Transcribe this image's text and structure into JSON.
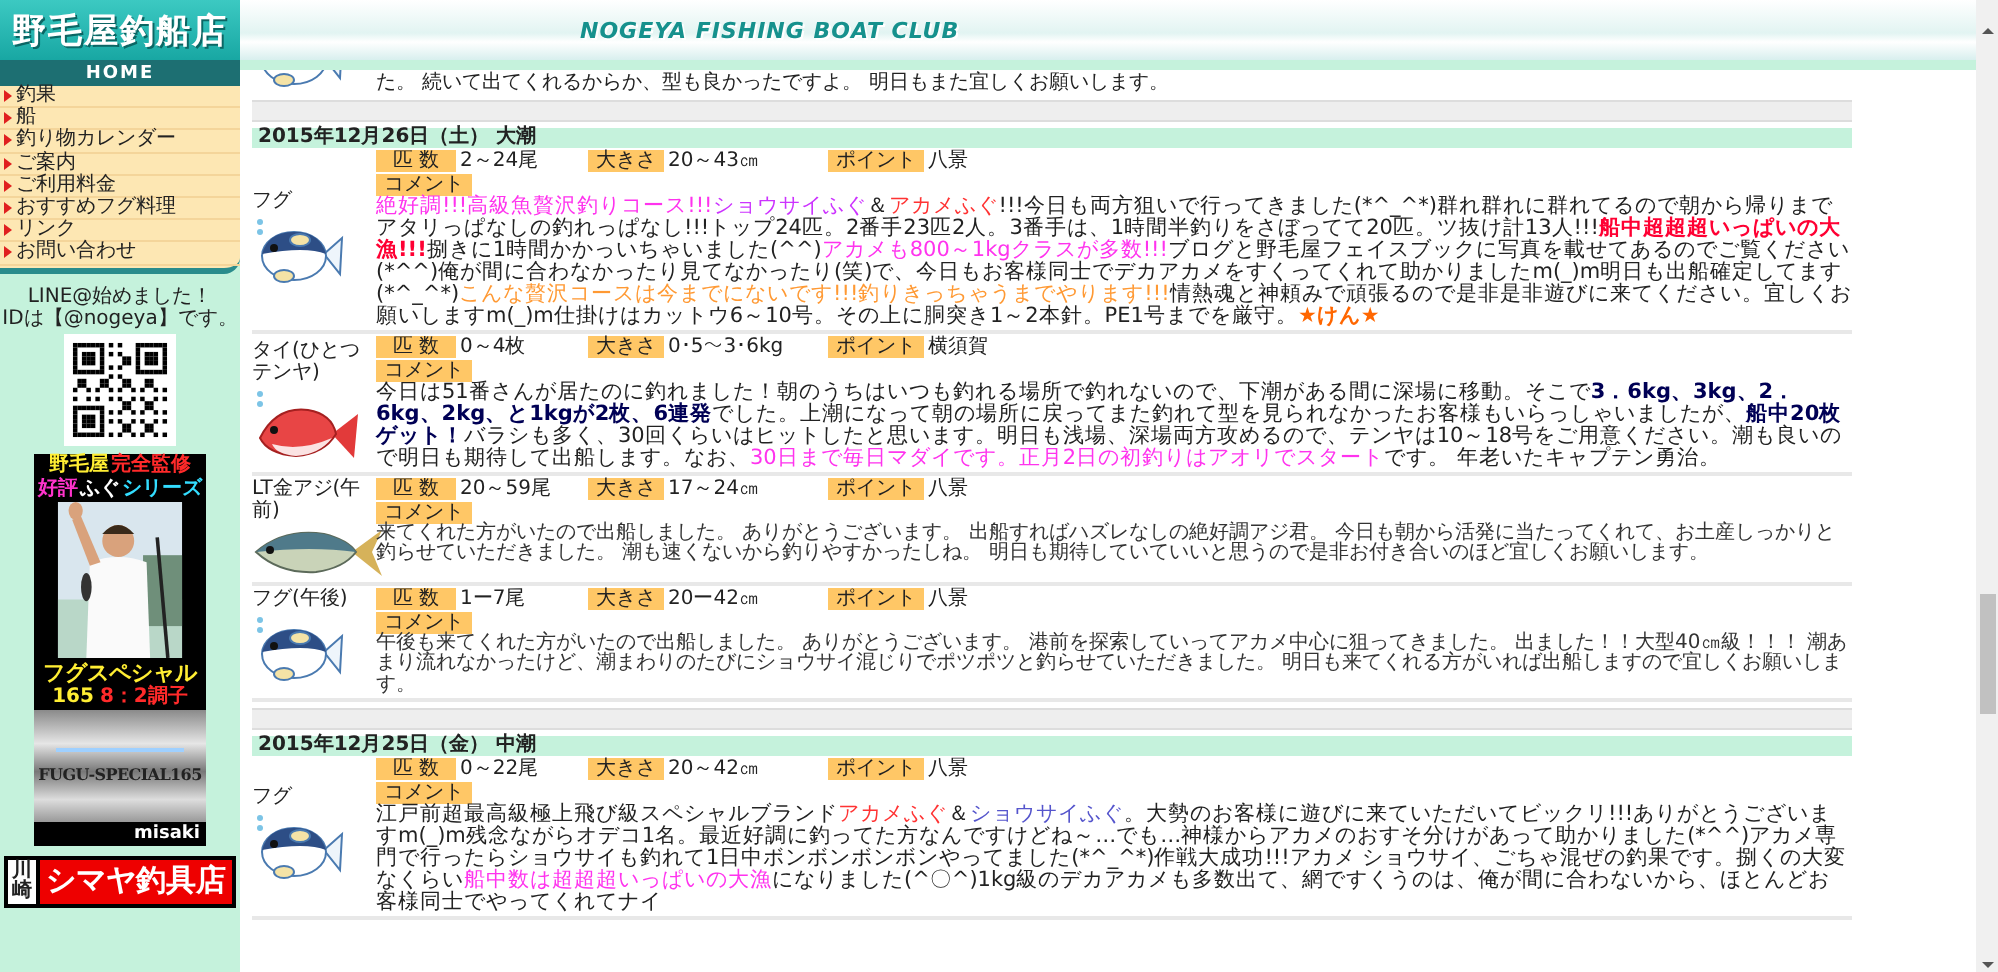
{
  "logo": {
    "title": "野毛屋釣船店"
  },
  "header": {
    "title": "NOGEYA FISHING BOAT CLUB"
  },
  "nav": {
    "home": "HOME",
    "items": [
      "釣果",
      "船",
      "釣り物カレンダー",
      "ご案内",
      "ご利用料金",
      "おすすめフグ料理",
      "リンク",
      "お問い合わせ"
    ]
  },
  "sidebar": {
    "line_notice": "LINE@始めました！",
    "line_id": "IDは【@nogeya】です。",
    "banner": {
      "maker": "野毛屋",
      "supervision": "完全監修",
      "praise": "好評",
      "series": "ふぐ",
      "series_word": "シリーズ",
      "product": "フグスペシャル",
      "length": "165",
      "action": "8：2調子",
      "rod_label": "FUGU-SPECIAL165",
      "brand": "misaki"
    },
    "shop": {
      "city": "川崎",
      "name": "シマヤ釣具店"
    }
  },
  "previous_entry": {
    "comment_tail": "た。 続いて出てくれるからか、型も良かったですよ。 明日もまた宜しくお願いします。"
  },
  "days": [
    {
      "date": "2015年12月26日（土） 大潮",
      "catches": [
        {
          "kind": "fugu",
          "fish": "フグ",
          "count_label": "匹 数",
          "count": "2～24尾",
          "size_label": "大きさ",
          "size": "20～43㎝",
          "point_label": "ポイント",
          "point": "八景",
          "comment_label": "コメント",
          "compact": false,
          "comment": [
            {
              "kind": "promo",
              "text": "絶好調!!!高級魚贅沢釣りコース!!!"
            },
            {
              "kind": "species",
              "text": "ショウサイふぐ"
            },
            {
              "kind": "plain",
              "text": "＆"
            },
            {
              "kind": "akame",
              "text": "アカメふぐ"
            },
            {
              "kind": "plain",
              "text": "!!!今日も両方狙いで行ってきました(*^_^*)群れ群れに群れてるので朝から帰りまでアタリっぱなしの釣れっぱなし!!!トップ24匹。2番手23匹2人。3番手は、1時間半釣りをさぼってて20匹。ツ抜け計13人!!!"
            },
            {
              "kind": "alert",
              "text": "船中超超超いっぱいの大漁!!!"
            },
            {
              "kind": "plain",
              "text": "捌きに1時間かかっいちゃいました(^^)"
            },
            {
              "kind": "promo",
              "text": "アカメも800～1kgクラスが多数!!!"
            },
            {
              "kind": "plain",
              "text": "ブログと野毛屋フェイスブックに写真を載せてあるのでご覧ください(*^^)俺が間に合わなかったり見てなかったり(笑)で、今日もお客様同士でデカアカメをすくってくれて助かりましたm(_)m明日も出船確定してます(*^_^*)"
            },
            {
              "kind": "notice",
              "text": "こんな贅沢コースは今までにないです!!!釣りきっちゃうまでやります!!!"
            },
            {
              "kind": "plain",
              "text": "情熱魂と神頼みで頑張るので是非是非遊びに来てください。宜しくお願いしますm(_)m仕掛けはカットウ6～10号。その上に胴突き1～2本針。PE1号までを厳守。"
            },
            {
              "kind": "sign",
              "text": "★けん★"
            }
          ]
        },
        {
          "kind": "tai",
          "fish": "タイ(ひとつテンヤ)",
          "count_label": "匹 数",
          "count": "0～4枚",
          "size_label": "大きさ",
          "size": "0･5～3･6kg",
          "point_label": "ポイント",
          "point": "横須賀",
          "comment_label": "コメント",
          "compact": false,
          "comment": [
            {
              "kind": "plain",
              "text": "今日は51番さんが居たのに釣れました！朝のうちはいつも釣れる場所で釣れないので、下潮がある間に深場に移動。そこで"
            },
            {
              "kind": "strong",
              "text": "3．6kg、3kg、2．6kg、2kg、と1kgが2枚、6連発"
            },
            {
              "kind": "plain",
              "text": "でした。上潮になって朝の場所に戻ってまた釣れて型を見られなかったお客様もいらっしゃいましたが、"
            },
            {
              "kind": "strong",
              "text": "船中20枚ゲット！"
            },
            {
              "kind": "plain",
              "text": "バラシも多く、30回くらいはヒットしたと思います。明日も浅場、深場両方攻めるので、テンヤは10～18号をご用意ください。潮も良いので明日も期待して出船します。なお、"
            },
            {
              "kind": "promo",
              "text": "30日まで毎日マダイです。正月2日の初釣りはアオリでスタート"
            },
            {
              "kind": "plain",
              "text": "です。 年老いたキャプテン勇治。"
            }
          ]
        },
        {
          "kind": "aji",
          "fish": "LT金アジ(午前)",
          "count_label": "匹 数",
          "count": "20～59尾",
          "size_label": "大きさ",
          "size": "17～24㎝",
          "point_label": "ポイント",
          "point": "八景",
          "comment_label": "コメント",
          "compact": true,
          "comment": [
            {
              "kind": "plain",
              "text": " 来てくれた方がいたので出船しました。 ありがとうございます。 出船すればハズレなしの絶好調アジ君。 今日も朝から活発に当たってくれて、お土産しっかりと釣らせていただきました。 潮も速くないから釣りやすかったしね。 明日も期待していていいと思うので是非お付き合いのほど宜しくお願いします。"
            }
          ]
        },
        {
          "kind": "fugu",
          "fish": "フグ(午後)",
          "count_label": "匹 数",
          "count": "1ー7尾",
          "size_label": "大きさ",
          "size": "20ー42㎝",
          "point_label": "ポイント",
          "point": "八景",
          "comment_label": "コメント",
          "compact": true,
          "comment": [
            {
              "kind": "plain",
              "text": " 午後も来てくれた方がいたので出船しました。 ありがとうございます。 港前を探索していってアカメ中心に狙ってきました。 出ました！！大型40㎝級！！！ 潮あまり流れなかったけど、潮まわりのたびにショウサイ混じりでポツポツと釣らせていただきました。 明日も来てくれる方がいれば出船しますので宜しくお願いします。"
            }
          ]
        }
      ]
    },
    {
      "date": "2015年12月25日（金） 中潮",
      "catches": [
        {
          "kind": "fugu",
          "fish": "フグ",
          "count_label": "匹 数",
          "count": "0～22尾",
          "size_label": "大きさ",
          "size": "20～42㎝",
          "point_label": "ポイント",
          "point": "八景",
          "comment_label": "コメント",
          "compact": false,
          "comment": [
            {
              "kind": "plain",
              "text": "江戸前超最高級極上飛び級スペシャルブランド"
            },
            {
              "kind": "akame",
              "text": "アカメふぐ"
            },
            {
              "kind": "plain",
              "text": "＆"
            },
            {
              "kind": "shousai",
              "text": "ショウサイふぐ"
            },
            {
              "kind": "plain",
              "text": "。大勢のお客様に遊びに来ていただいてビックリ!!!ありがとうございますm(_)m残念ながらオデコ1名。最近好調に釣ってた方なんですけどね～…でも…神様からアカメのおすそ分けがあって助かりました(*^^)アカメ専門で行ったらショウサイも釣れて1日中ボンボンボンボンやってました(*^_^*)作戦大成功!!!アカメ ショウサイ、ごちゃ混ぜの釣果です。捌くの大変なくらい"
            },
            {
              "kind": "promo",
              "text": "船中数は超超超いっぱいの大漁"
            },
            {
              "kind": "plain",
              "text": "になりました(^〇^)1kg級のデカアカメも多数出て、網ですくうのは、俺が間に合わないから、ほとんどお客様同士でやってくれてナイ"
            }
          ]
        }
      ]
    }
  ]
}
